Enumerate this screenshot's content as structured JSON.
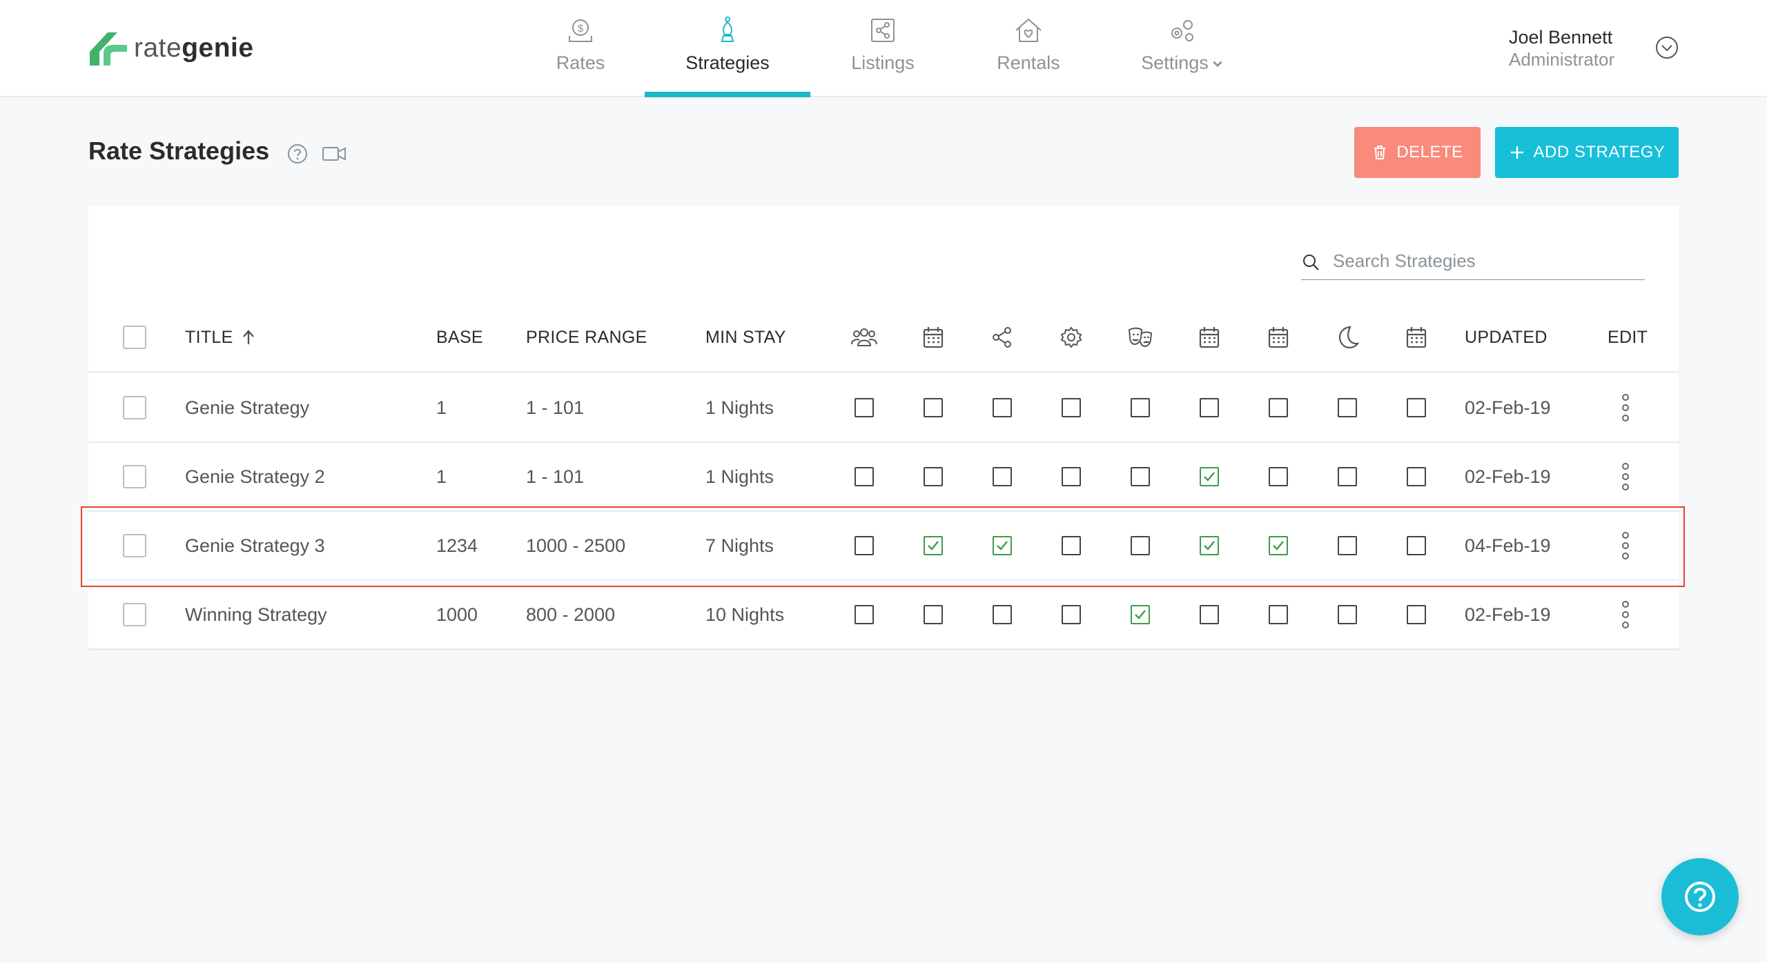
{
  "brand": {
    "part1": "rate",
    "part2": "genie",
    "accent": "#1bb8c8",
    "logo_green": "#3fb36a"
  },
  "nav": {
    "items": [
      {
        "label": "Rates",
        "icon": "money-icon"
      },
      {
        "label": "Strategies",
        "icon": "chess-bishop-icon",
        "active": true
      },
      {
        "label": "Listings",
        "icon": "share-listings-icon"
      },
      {
        "label": "Rentals",
        "icon": "house-heart-icon"
      },
      {
        "label": "Settings",
        "icon": "gears-icon"
      }
    ]
  },
  "user": {
    "name": "Joel Bennett",
    "role": "Administrator"
  },
  "page": {
    "title": "Rate Strategies"
  },
  "buttons": {
    "delete": "DELETE",
    "add": "ADD STRATEGY"
  },
  "search": {
    "placeholder": "Search Strategies",
    "value": ""
  },
  "table": {
    "columns": {
      "title": "TITLE",
      "base": "BASE",
      "price_range": "PRICE RANGE",
      "min_stay": "MIN STAY",
      "updated": "UPDATED",
      "edit": "EDIT"
    },
    "icon_columns": [
      "group-icon",
      "calendar-icon",
      "share-icon",
      "gear-icon",
      "theater-masks-icon",
      "calendar-icon",
      "calendar-icon",
      "moon-icon",
      "calendar-icon"
    ],
    "rows": [
      {
        "title": "Genie Strategy",
        "base": "1",
        "price_range": "1 - 101",
        "min_stay": "1 Nights",
        "flags": [
          false,
          false,
          false,
          false,
          false,
          false,
          false,
          false,
          false
        ],
        "updated": "02-Feb-19"
      },
      {
        "title": "Genie Strategy 2",
        "base": "1",
        "price_range": "1 - 101",
        "min_stay": "1 Nights",
        "flags": [
          false,
          false,
          false,
          false,
          false,
          true,
          false,
          false,
          false
        ],
        "updated": "02-Feb-19"
      },
      {
        "title": "Genie Strategy 3",
        "base": "1234",
        "price_range": "1000 - 2500",
        "min_stay": "7 Nights",
        "flags": [
          false,
          true,
          true,
          false,
          false,
          true,
          true,
          false,
          false
        ],
        "updated": "04-Feb-19"
      },
      {
        "title": "Winning Strategy",
        "base": "1000",
        "price_range": "800 - 2000",
        "min_stay": "10 Nights",
        "flags": [
          false,
          false,
          false,
          false,
          true,
          false,
          false,
          false,
          false
        ],
        "updated": "02-Feb-19"
      }
    ]
  }
}
